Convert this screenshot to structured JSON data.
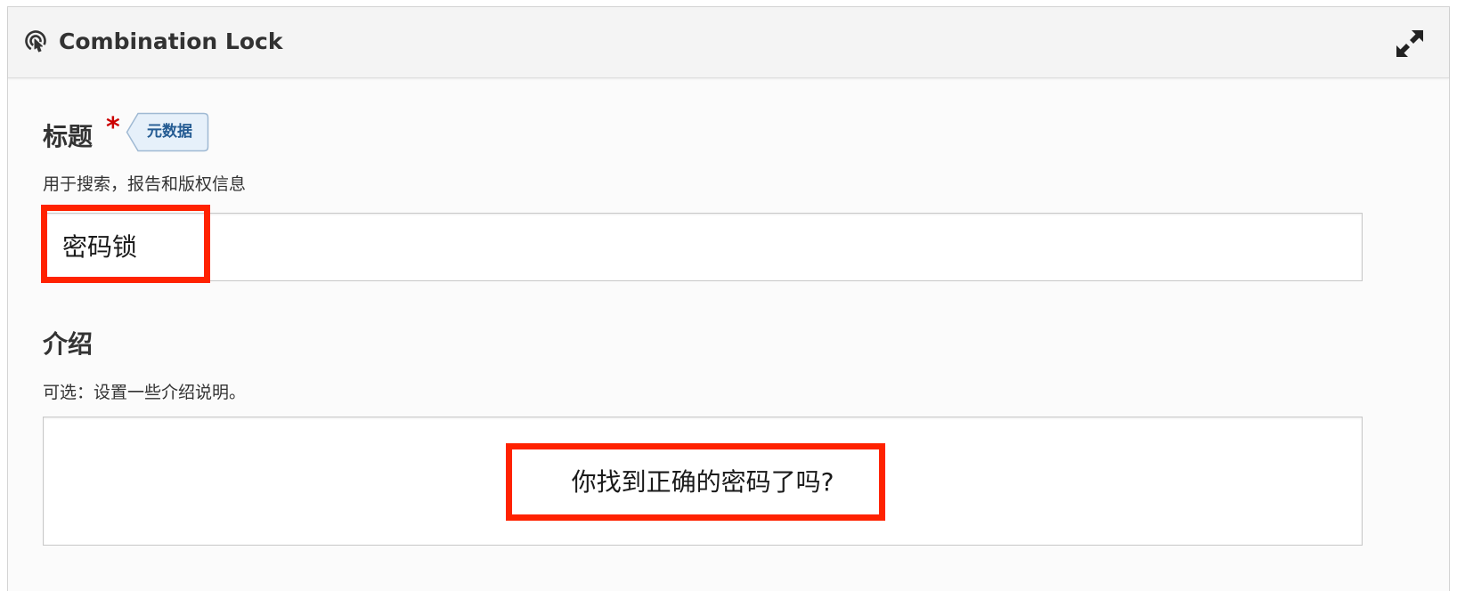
{
  "panel": {
    "title": "Combination Lock",
    "header_icon": "touch-pointer-icon",
    "expand_icon": "expand-arrows-icon"
  },
  "fields": {
    "title": {
      "label": "标题",
      "required_mark": "*",
      "meta_tag": "元数据",
      "description": "用于搜索，报告和版权信息",
      "value": "密码锁"
    },
    "intro": {
      "label": "介绍",
      "description": "可选：设置一些介绍说明。",
      "value": "你找到正确的密码了吗?"
    }
  },
  "colors": {
    "highlight": "#ff2200",
    "required": "#cc0000",
    "meta_tag_text": "#245b93",
    "meta_tag_bg": "#e6f0fa"
  }
}
